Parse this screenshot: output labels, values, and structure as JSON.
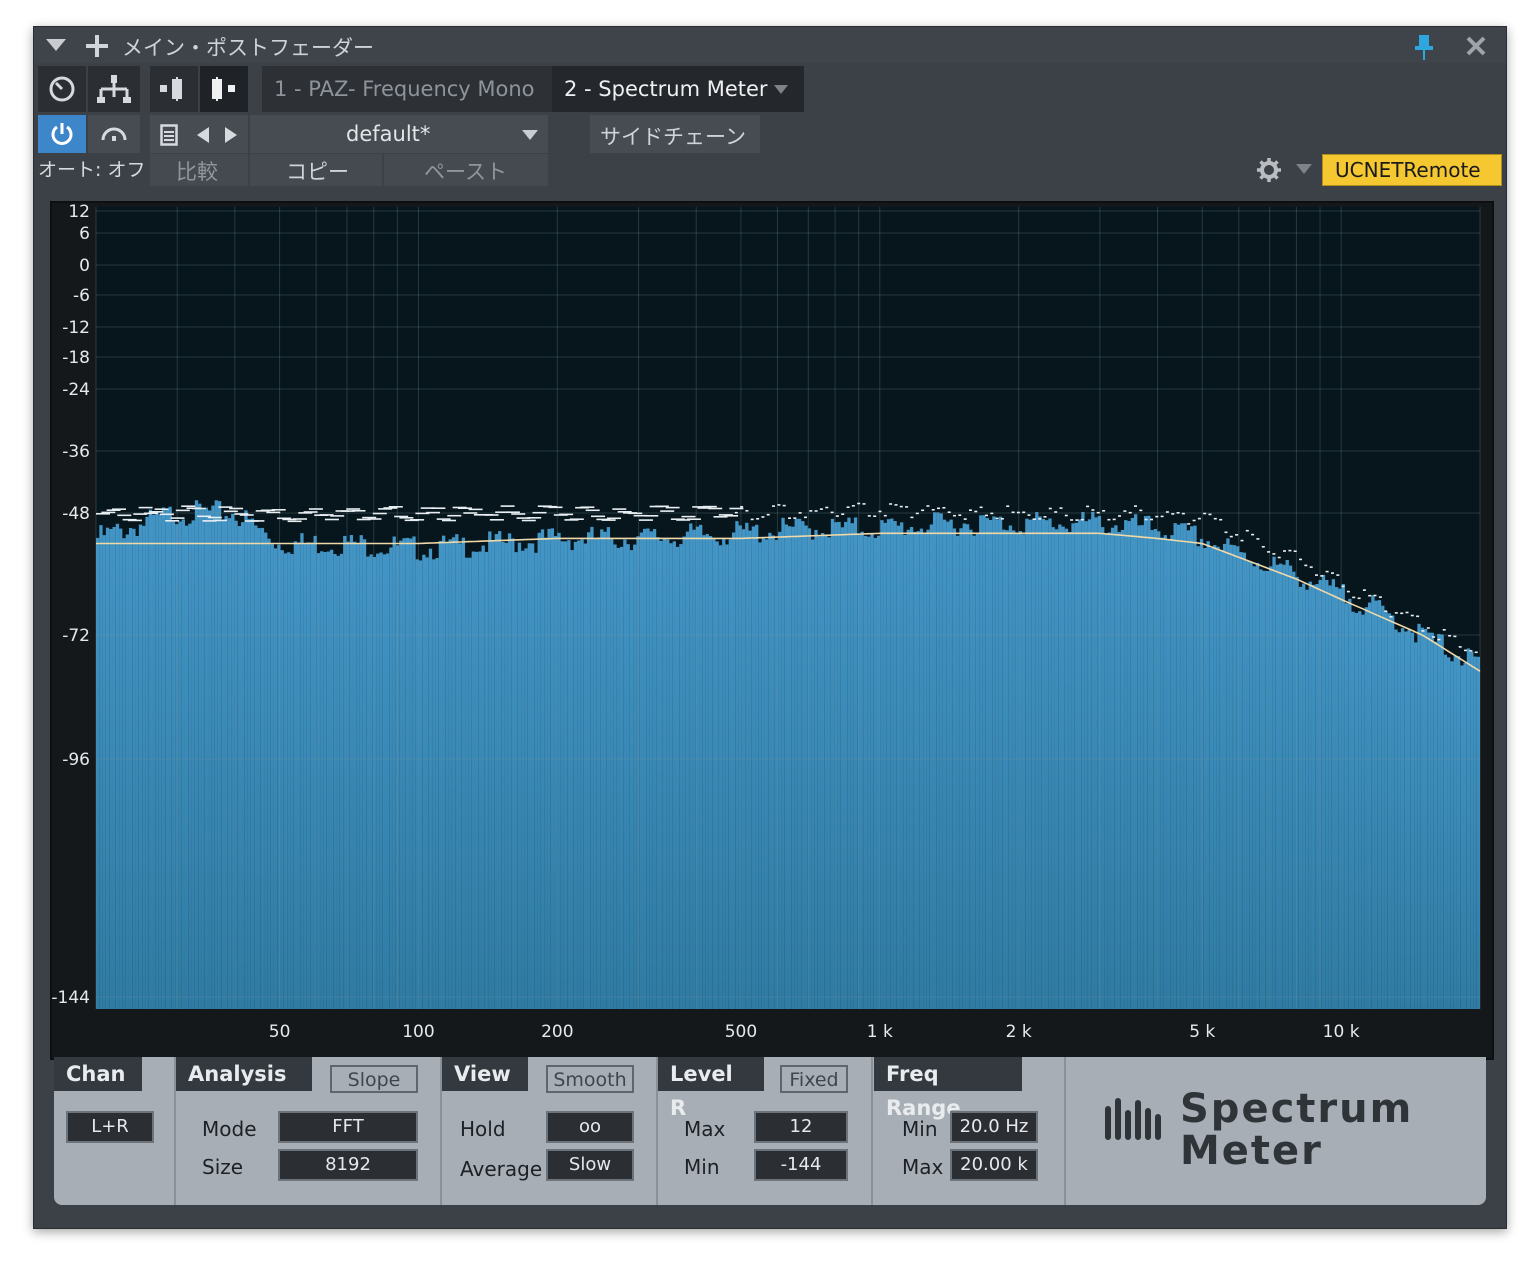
{
  "window": {
    "title": "メイン・ポストフェーダー"
  },
  "tabs": [
    {
      "label": "1 - PAZ- Frequency Mono"
    },
    {
      "label": "2 - Spectrum Meter"
    }
  ],
  "preset": {
    "name": "default*"
  },
  "sidechain_label": "サイドチェーン",
  "auto_label": "オート: オフ",
  "compare_label": "比較",
  "copy_label": "コピー",
  "paste_label": "ペースト",
  "remote_label": "UCNETRemote",
  "colors": {
    "accent": "#f5c731",
    "spectrum": "#3e8fbe",
    "graph_bg": "#06161c",
    "power": "#3c86c9"
  },
  "icons": [
    "dropdown-arrow-icon",
    "plus-icon",
    "pin-icon",
    "close-icon",
    "clock-icon",
    "routing-icon",
    "channel-icon",
    "insert-icon",
    "power-icon",
    "bypass-icon",
    "preset-icon",
    "prev-icon",
    "next-icon",
    "gear-icon"
  ],
  "chart_data": {
    "type": "area",
    "x_scale": "log",
    "xlim": [
      20,
      20000
    ],
    "ylim": [
      -144,
      12
    ],
    "y_ticks": [
      "12",
      "6",
      "0",
      "-6",
      "-12",
      "-18",
      "-24",
      "-36",
      "-48",
      "-72",
      "-96",
      "-144"
    ],
    "x_ticks": [
      "50",
      "100",
      "200",
      "500",
      "1 k",
      "2 k",
      "5 k",
      "10 k"
    ],
    "grid": true,
    "series": [
      {
        "x": [
          20,
          30,
          40,
          50,
          70,
          100,
          150,
          200,
          300,
          500,
          700,
          1000,
          1500,
          2000,
          3000,
          4000,
          5000,
          6000,
          8000,
          10000,
          12000,
          15000,
          20000
        ],
        "y": [
          -53,
          -48,
          -48,
          -54,
          -54,
          -55,
          -54,
          -53,
          -53,
          -52,
          -51,
          -51,
          -50,
          -50,
          -50,
          -51,
          -53,
          -56,
          -60,
          -64,
          -67,
          -72,
          -78
        ]
      },
      {
        "x": [
          20,
          50,
          100,
          200,
          500,
          1000,
          2000,
          3000,
          4000,
          5000,
          8000,
          10000,
          15000,
          20000
        ],
        "y": [
          -54,
          -54,
          -54,
          -53,
          -53,
          -52,
          -52,
          -52,
          -53,
          -54,
          -61,
          -65,
          -72,
          -79
        ]
      },
      {
        "x": [
          20,
          50,
          100,
          200,
          500,
          1000,
          2000,
          3000,
          4000,
          5000,
          8000,
          10000,
          15000,
          20000
        ],
        "y": [
          -48,
          -48,
          -48,
          -48,
          -48,
          -47,
          -48,
          -48,
          -48,
          -49,
          -57,
          -62,
          -70,
          -75
        ]
      }
    ]
  },
  "controls": {
    "chan": {
      "title": "Chan",
      "value": "L+R"
    },
    "analysis": {
      "title": "Analysis",
      "slope_label": "Slope",
      "mode_label": "Mode",
      "mode_value": "FFT",
      "size_label": "Size",
      "size_value": "8192"
    },
    "view": {
      "title": "View",
      "smooth_label": "Smooth",
      "hold_label": "Hold",
      "hold_value": "oo",
      "average_label": "Average",
      "average_value": "Slow"
    },
    "level": {
      "title": "Level R",
      "fixed_label": "Fixed",
      "max_label": "Max",
      "max_value": "12",
      "min_label": "Min",
      "min_value": "-144"
    },
    "freq": {
      "title": "Freq Range",
      "min_label": "Min",
      "min_value": "20.0 Hz",
      "max_label": "Max",
      "max_value": "20.00 k"
    }
  },
  "logo": {
    "line1": "Spectrum",
    "line2": "Meter"
  }
}
